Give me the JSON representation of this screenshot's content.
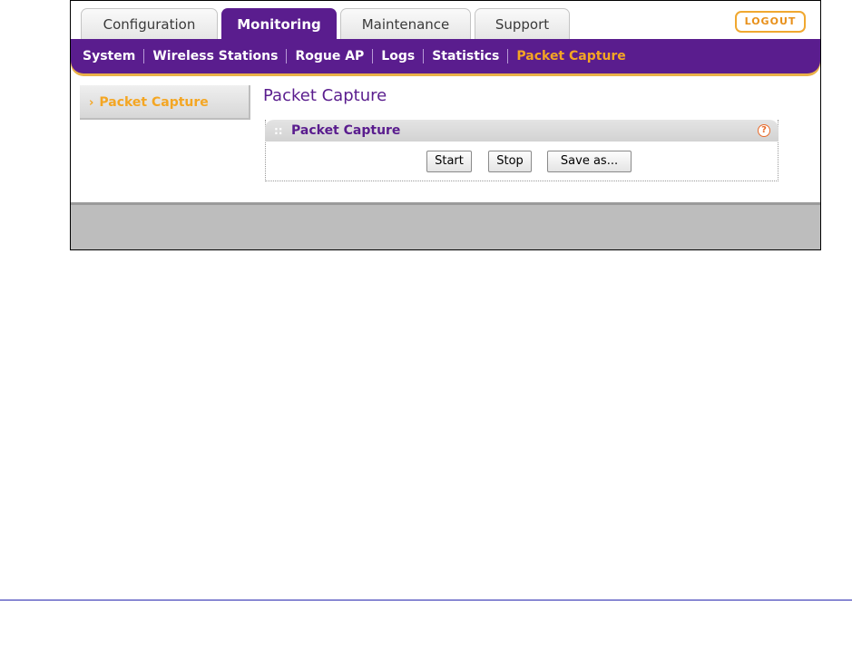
{
  "tabs": [
    {
      "label": "Configuration",
      "active": false
    },
    {
      "label": "Monitoring",
      "active": true
    },
    {
      "label": "Maintenance",
      "active": false
    },
    {
      "label": "Support",
      "active": false
    }
  ],
  "logout_label": "LOGOUT",
  "subnav": [
    {
      "label": "System",
      "active": false
    },
    {
      "label": "Wireless Stations",
      "active": false
    },
    {
      "label": "Rogue AP",
      "active": false
    },
    {
      "label": "Logs",
      "active": false
    },
    {
      "label": "Statistics",
      "active": false
    },
    {
      "label": "Packet Capture",
      "active": true
    }
  ],
  "sidebar": {
    "items": [
      {
        "label": "Packet Capture",
        "icon": "chevron-right-icon",
        "active": true
      }
    ]
  },
  "page": {
    "title": "Packet Capture"
  },
  "panel": {
    "grip": "::",
    "title": "Packet Capture",
    "help_symbol": "?",
    "buttons": {
      "start": "Start",
      "stop": "Stop",
      "save": "Save as..."
    }
  },
  "colors": {
    "brand_purple": "#5a1d8e",
    "accent_orange": "#f4a623",
    "footer_gray": "#bdbdbd"
  }
}
